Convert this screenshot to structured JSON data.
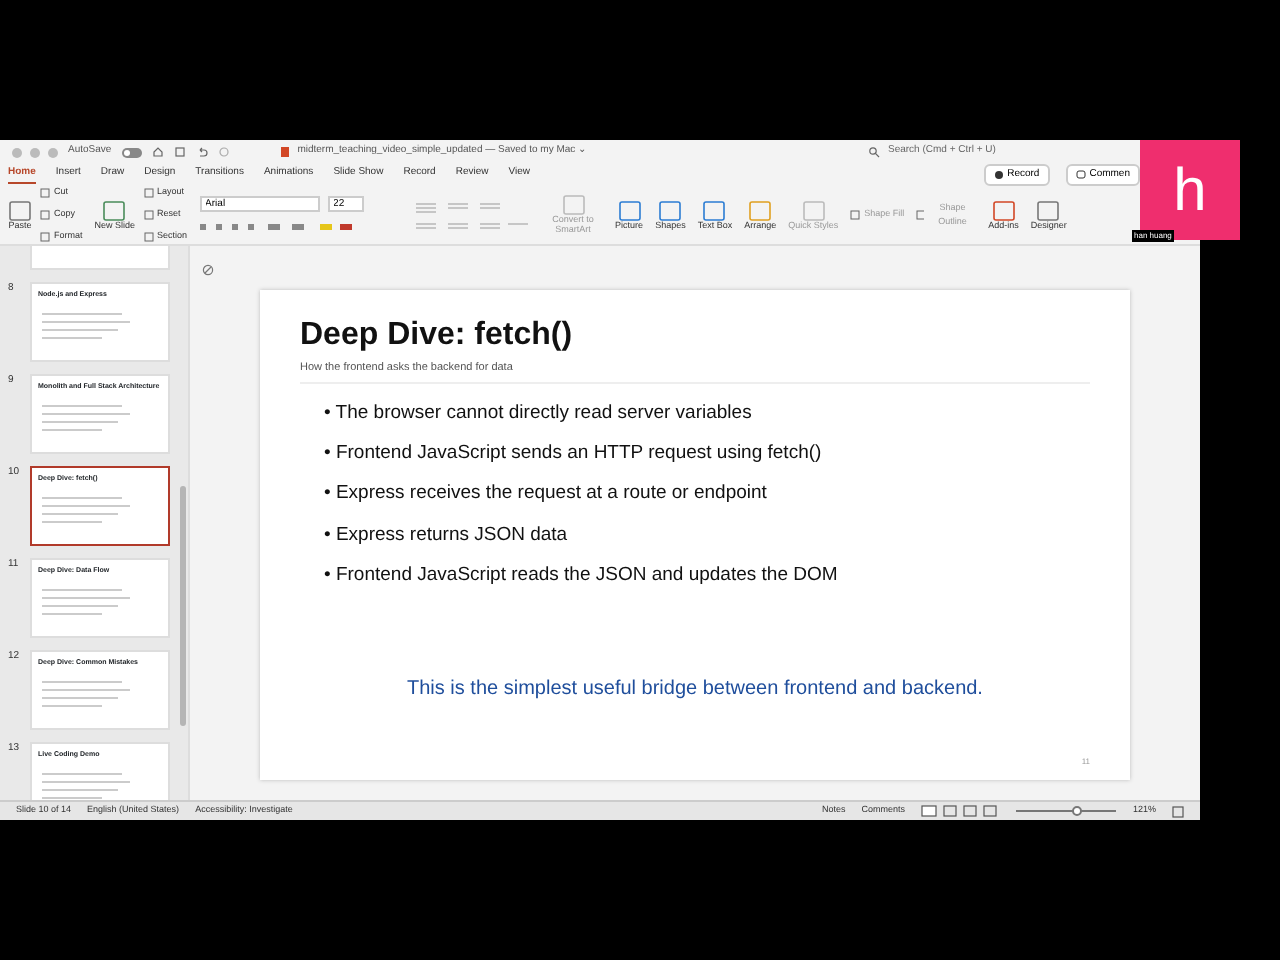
{
  "title_bar": {
    "autosave_label": "AutoSave",
    "autosave_on": false,
    "document": "midterm_teaching_video_simple_updated — Saved to my Mac ⌄",
    "search_placeholder": "Search (Cmd + Ctrl + U)"
  },
  "ribbon_tabs": [
    {
      "label": "Home",
      "selected": true
    },
    {
      "label": "Insert",
      "selected": false
    },
    {
      "label": "Draw",
      "selected": false
    },
    {
      "label": "Design",
      "selected": false
    },
    {
      "label": "Transitions",
      "selected": false
    },
    {
      "label": "Animations",
      "selected": false
    },
    {
      "label": "Slide Show",
      "selected": false
    },
    {
      "label": "Record",
      "selected": false
    },
    {
      "label": "Review",
      "selected": false
    },
    {
      "label": "View",
      "selected": false
    }
  ],
  "record_button": "Record",
  "comment_button": "Commen",
  "ribbon": {
    "clipboard": {
      "paste": "Paste",
      "cut": "Cut",
      "copy": "Copy",
      "format": "Format"
    },
    "slides": {
      "new_slide": "New Slide",
      "layout": "Layout",
      "reset": "Reset",
      "section": "Section"
    },
    "font": {
      "name": "Arial",
      "size": "22"
    },
    "tools": [
      {
        "label": "Convert to SmartArt",
        "kind": "faded"
      },
      {
        "label": "Picture",
        "kind": "picture"
      },
      {
        "label": "Shapes",
        "kind": "shapes"
      },
      {
        "label": "Text Box",
        "kind": "textbox"
      },
      {
        "label": "Arrange",
        "kind": "arrange"
      },
      {
        "label": "Quick Styles",
        "kind": "faded"
      },
      {
        "label": "Shape Fill",
        "kind": "small"
      },
      {
        "label": "Shape Outline",
        "kind": "small"
      },
      {
        "label": "Add-ins",
        "kind": "addins"
      },
      {
        "label": "Designer",
        "kind": "designer"
      }
    ]
  },
  "thumbnails": [
    {
      "selected": false
    },
    {
      "number": "8",
      "title": "Node.js and Express",
      "selected": false
    },
    {
      "number": "9",
      "title": "Monolith and Full Stack Architecture",
      "selected": false
    },
    {
      "number": "10",
      "title": "Deep Dive: fetch()",
      "selected": true
    },
    {
      "number": "11",
      "title": "Deep Dive: Data Flow",
      "selected": false
    },
    {
      "number": "12",
      "title": "Deep Dive: Common Mistakes",
      "selected": false
    },
    {
      "number": "13",
      "title": "Live Coding Demo",
      "selected": false
    }
  ],
  "slide": {
    "title": "Deep Dive: fetch()",
    "subtitle": "How the frontend asks the backend for data",
    "bullet_mark": "•",
    "bullets": [
      "The browser cannot directly read server variables",
      "Frontend JavaScript sends an HTTP request using fetch()",
      "Express receives the request at a route or endpoint",
      "Express returns JSON data",
      "Frontend JavaScript reads the JSON and updates the DOM"
    ],
    "note": "This is the simplest useful bridge between frontend and backend.",
    "page_number": "11"
  },
  "status_bar": {
    "slide_position": "Slide 10 of 14",
    "language": "English (United States)",
    "accessibility": "Accessibility: Investigate",
    "notes": "Notes",
    "comments": "Comments",
    "zoom": {
      "level": 0.6
    },
    "zoom_percent": "121%"
  },
  "participant_tile": {
    "initial": "h",
    "name": "han huang"
  }
}
